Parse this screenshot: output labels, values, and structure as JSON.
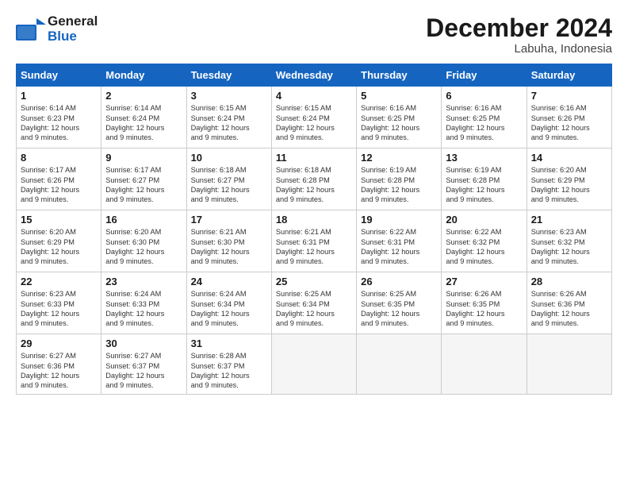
{
  "logo": {
    "general": "General",
    "blue": "Blue"
  },
  "title": "December 2024",
  "location": "Labuha, Indonesia",
  "days_of_week": [
    "Sunday",
    "Monday",
    "Tuesday",
    "Wednesday",
    "Thursday",
    "Friday",
    "Saturday"
  ],
  "weeks": [
    [
      {
        "day": "1",
        "sunrise": "6:14 AM",
        "sunset": "6:23 PM",
        "daylight": "12 hours and 9 minutes."
      },
      {
        "day": "2",
        "sunrise": "6:14 AM",
        "sunset": "6:24 PM",
        "daylight": "12 hours and 9 minutes."
      },
      {
        "day": "3",
        "sunrise": "6:15 AM",
        "sunset": "6:24 PM",
        "daylight": "12 hours and 9 minutes."
      },
      {
        "day": "4",
        "sunrise": "6:15 AM",
        "sunset": "6:24 PM",
        "daylight": "12 hours and 9 minutes."
      },
      {
        "day": "5",
        "sunrise": "6:16 AM",
        "sunset": "6:25 PM",
        "daylight": "12 hours and 9 minutes."
      },
      {
        "day": "6",
        "sunrise": "6:16 AM",
        "sunset": "6:25 PM",
        "daylight": "12 hours and 9 minutes."
      },
      {
        "day": "7",
        "sunrise": "6:16 AM",
        "sunset": "6:26 PM",
        "daylight": "12 hours and 9 minutes."
      }
    ],
    [
      {
        "day": "8",
        "sunrise": "6:17 AM",
        "sunset": "6:26 PM",
        "daylight": "12 hours and 9 minutes."
      },
      {
        "day": "9",
        "sunrise": "6:17 AM",
        "sunset": "6:27 PM",
        "daylight": "12 hours and 9 minutes."
      },
      {
        "day": "10",
        "sunrise": "6:18 AM",
        "sunset": "6:27 PM",
        "daylight": "12 hours and 9 minutes."
      },
      {
        "day": "11",
        "sunrise": "6:18 AM",
        "sunset": "6:28 PM",
        "daylight": "12 hours and 9 minutes."
      },
      {
        "day": "12",
        "sunrise": "6:19 AM",
        "sunset": "6:28 PM",
        "daylight": "12 hours and 9 minutes."
      },
      {
        "day": "13",
        "sunrise": "6:19 AM",
        "sunset": "6:28 PM",
        "daylight": "12 hours and 9 minutes."
      },
      {
        "day": "14",
        "sunrise": "6:20 AM",
        "sunset": "6:29 PM",
        "daylight": "12 hours and 9 minutes."
      }
    ],
    [
      {
        "day": "15",
        "sunrise": "6:20 AM",
        "sunset": "6:29 PM",
        "daylight": "12 hours and 9 minutes."
      },
      {
        "day": "16",
        "sunrise": "6:20 AM",
        "sunset": "6:30 PM",
        "daylight": "12 hours and 9 minutes."
      },
      {
        "day": "17",
        "sunrise": "6:21 AM",
        "sunset": "6:30 PM",
        "daylight": "12 hours and 9 minutes."
      },
      {
        "day": "18",
        "sunrise": "6:21 AM",
        "sunset": "6:31 PM",
        "daylight": "12 hours and 9 minutes."
      },
      {
        "day": "19",
        "sunrise": "6:22 AM",
        "sunset": "6:31 PM",
        "daylight": "12 hours and 9 minutes."
      },
      {
        "day": "20",
        "sunrise": "6:22 AM",
        "sunset": "6:32 PM",
        "daylight": "12 hours and 9 minutes."
      },
      {
        "day": "21",
        "sunrise": "6:23 AM",
        "sunset": "6:32 PM",
        "daylight": "12 hours and 9 minutes."
      }
    ],
    [
      {
        "day": "22",
        "sunrise": "6:23 AM",
        "sunset": "6:33 PM",
        "daylight": "12 hours and 9 minutes."
      },
      {
        "day": "23",
        "sunrise": "6:24 AM",
        "sunset": "6:33 PM",
        "daylight": "12 hours and 9 minutes."
      },
      {
        "day": "24",
        "sunrise": "6:24 AM",
        "sunset": "6:34 PM",
        "daylight": "12 hours and 9 minutes."
      },
      {
        "day": "25",
        "sunrise": "6:25 AM",
        "sunset": "6:34 PM",
        "daylight": "12 hours and 9 minutes."
      },
      {
        "day": "26",
        "sunrise": "6:25 AM",
        "sunset": "6:35 PM",
        "daylight": "12 hours and 9 minutes."
      },
      {
        "day": "27",
        "sunrise": "6:26 AM",
        "sunset": "6:35 PM",
        "daylight": "12 hours and 9 minutes."
      },
      {
        "day": "28",
        "sunrise": "6:26 AM",
        "sunset": "6:36 PM",
        "daylight": "12 hours and 9 minutes."
      }
    ],
    [
      {
        "day": "29",
        "sunrise": "6:27 AM",
        "sunset": "6:36 PM",
        "daylight": "12 hours and 9 minutes."
      },
      {
        "day": "30",
        "sunrise": "6:27 AM",
        "sunset": "6:37 PM",
        "daylight": "12 hours and 9 minutes."
      },
      {
        "day": "31",
        "sunrise": "6:28 AM",
        "sunset": "6:37 PM",
        "daylight": "12 hours and 9 minutes."
      },
      null,
      null,
      null,
      null
    ]
  ],
  "labels": {
    "sunrise": "Sunrise:",
    "sunset": "Sunset:",
    "daylight": "Daylight:"
  }
}
